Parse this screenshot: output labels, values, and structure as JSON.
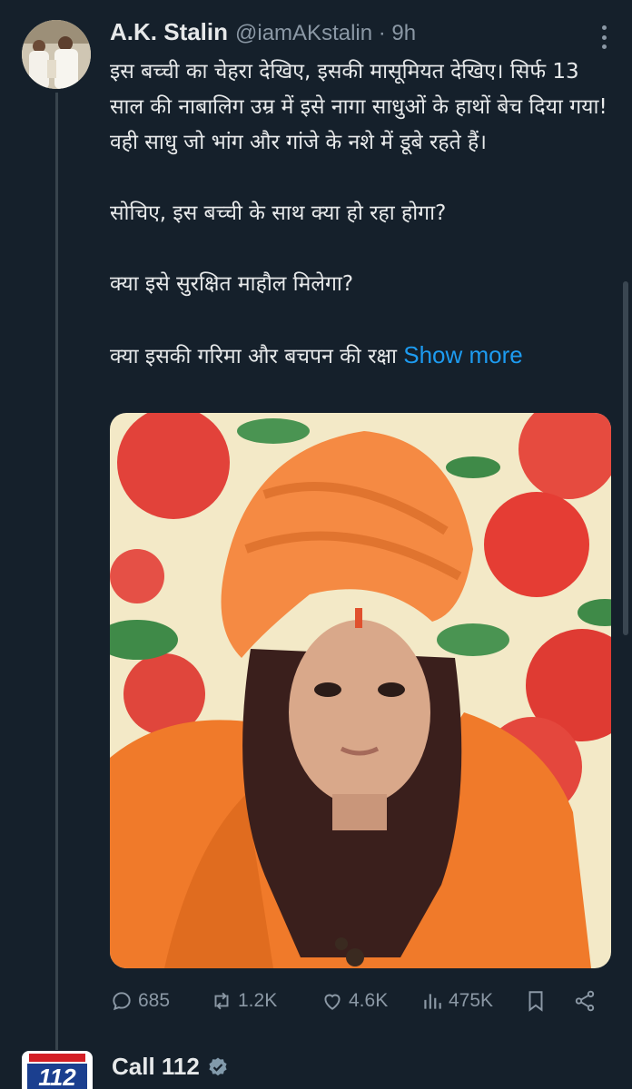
{
  "tweet": {
    "author_name": "A.K. Stalin",
    "author_handle": "@iamAKstalin · 9h",
    "paragraphs": [
      "इस बच्ची का चेहरा देखिए, इसकी मासूमियत देखिए। सिर्फ 13 साल की नाबालिग उम्र में इसे नागा साधुओं के हाथों बेच दिया गया! वही साधु जो भांग और गांजे के नशे में डूबे रहते हैं।",
      "सोचिए, इस बच्ची के साथ क्या हो रहा होगा?",
      "क्या इसे सुरक्षित माहौल मिलेगा?",
      "क्या इसकी गरिमा और बचपन की रक्षा"
    ],
    "show_more": "Show more",
    "stats": {
      "replies": "685",
      "reposts": "1.2K",
      "likes": "4.6K",
      "views": "475K"
    }
  },
  "next_tweet": {
    "author_name": "Call 112",
    "avatar_text": "112"
  },
  "icons": {
    "more": "more-vertical-icon",
    "reply": "reply-icon",
    "repost": "repost-icon",
    "like": "heart-icon",
    "views": "views-icon",
    "bookmark": "bookmark-icon",
    "share": "share-icon",
    "verified": "verified-badge-icon"
  },
  "colors": {
    "background": "#15202b",
    "text": "#e7e9ea",
    "muted": "#8b98a5",
    "link": "#1d9bf0",
    "verified": "#829aab"
  }
}
